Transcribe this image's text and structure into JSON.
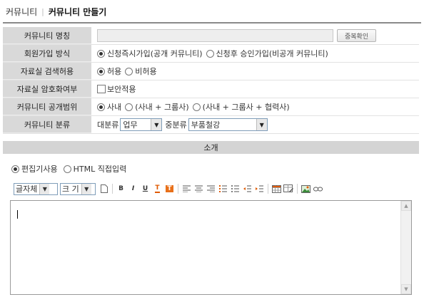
{
  "breadcrumb": {
    "root": "커뮤니티",
    "separator": "|",
    "current": "커뮤니티 만들기"
  },
  "form": {
    "name_row": {
      "label": "커뮤니티 명칭",
      "value": "",
      "check_button": "중복확인"
    },
    "join_row": {
      "label": "회원가입 방식",
      "options": [
        "신청즉시가입(공개 커뮤니티)",
        "신청후 승인가입(비공개 커뮤니티)"
      ],
      "selected": 0
    },
    "search_row": {
      "label": "자료실 검색허용",
      "options": [
        "허용",
        "비허용"
      ],
      "selected": 0
    },
    "encrypt_row": {
      "label": "자료실 암호화여부",
      "checkbox_label": "보안적용",
      "checked": false
    },
    "scope_row": {
      "label": "커뮤니티 공개범위",
      "options": [
        "사내",
        "(사내 + 그룹사)",
        "(사내 + 그룹사 + 협력사)"
      ],
      "selected": 0
    },
    "category_row": {
      "label": "커뮤니티 분류",
      "major_label": "대분류",
      "major_value": "업무",
      "minor_label": "중분류",
      "minor_value": "부품철강"
    }
  },
  "section": {
    "title": "소개"
  },
  "editor_mode": {
    "options": [
      "편집기사용",
      "HTML 직접입력"
    ],
    "selected": 0
  },
  "toolbar": {
    "font_select": "글자체",
    "size_select": "크 기"
  },
  "editor": {
    "content": ""
  },
  "colors": {
    "label_bg": "#d9d9d9",
    "section_bg": "#d4d4d4",
    "rule": "#8a8a8a",
    "font_color_icon": "#e05a00",
    "highlight_icon": "#e8701a"
  }
}
